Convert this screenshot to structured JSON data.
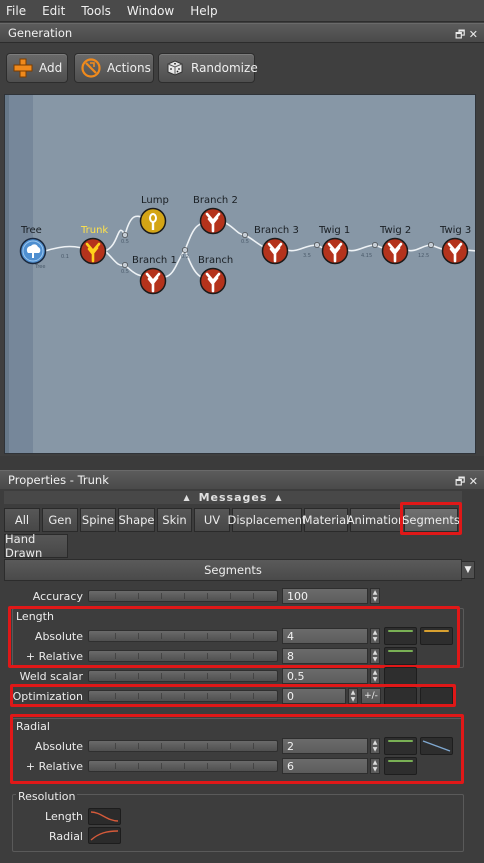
{
  "menu": [
    "File",
    "Edit",
    "Tools",
    "Window",
    "Help"
  ],
  "generation_panel": {
    "title": "Generation",
    "controls": "🗗 ✕"
  },
  "toolbar": {
    "add_label": "Add",
    "actions_label": "Actions",
    "randomize_label": "Randomize"
  },
  "graph": {
    "nodes": {
      "tree": "Tree",
      "trunk": "Trunk",
      "lump": "Lump",
      "branch1": "Branch 1",
      "branch2": "Branch 2",
      "branch_plain": "Branch",
      "branch3": "Branch 3",
      "twig1": "Twig 1",
      "twig2": "Twig 2",
      "twig3": "Twig 3"
    },
    "colors": {
      "node_red": "#b4331c",
      "node_yellow": "#d4a516",
      "node_blue": "#4f8fd0",
      "label_selected": "#ffe24a"
    }
  },
  "properties_panel": {
    "title": "Properties - Trunk",
    "controls": "🗗 ✕",
    "messages_label": "Messages",
    "tabs": [
      "All",
      "Gen",
      "Spine",
      "Shape",
      "Skin",
      "UV",
      "Displacement",
      "Material",
      "Animation",
      "Segments",
      "Hand Drawn"
    ],
    "active_tab": "Segments",
    "section_title": "Segments",
    "accuracy": {
      "label": "Accuracy",
      "value": "100"
    },
    "length_group": {
      "title": "Length",
      "absolute": {
        "label": "Absolute",
        "value": "4"
      },
      "relative": {
        "label": "+ Relative",
        "value": "8"
      }
    },
    "weld_scalar": {
      "label": "Weld scalar",
      "value": "0.5"
    },
    "optimization": {
      "label": "Optimization",
      "value": "0",
      "pm": "+/-"
    },
    "radial_group": {
      "title": "Radial",
      "absolute": {
        "label": "Absolute",
        "value": "2"
      },
      "relative": {
        "label": "+ Relative",
        "value": "6"
      }
    },
    "resolution_group": {
      "title": "Resolution",
      "length_label": "Length",
      "radial_label": "Radial"
    },
    "highlight_color": "#e01818"
  }
}
